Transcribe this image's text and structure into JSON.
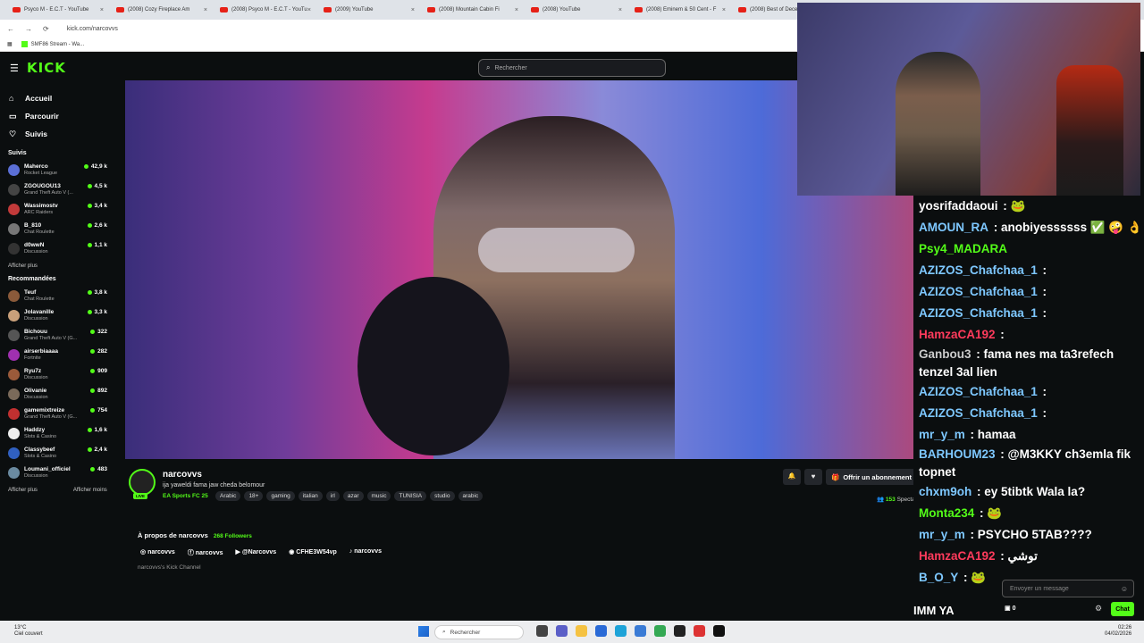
{
  "browser": {
    "tabs": [
      {
        "label": "Psyco M - E.C.T - YouTube"
      },
      {
        "label": "(2008) Cozy Fireplace Am"
      },
      {
        "label": "(2008) Psyco M - E.C.T - YouTu"
      },
      {
        "label": "(2009) YouTube"
      },
      {
        "label": "(2008) Mountain Cabin Fi"
      },
      {
        "label": "(2008) YouTube"
      },
      {
        "label": "(2008) Eminem & 50 Cent - F"
      },
      {
        "label": "(2008) Best of Dece"
      }
    ],
    "url": "kick.com/narcovvs",
    "bookmark": "SMF86 Stream - Wa..."
  },
  "header": {
    "logo": "KICK",
    "search_placeholder": "Rechercher"
  },
  "sidebar": {
    "nav": [
      {
        "label": "Accueil",
        "icon": "home-icon"
      },
      {
        "label": "Parcourir",
        "icon": "browse-icon"
      },
      {
        "label": "Suivis",
        "icon": "heart-icon"
      }
    ],
    "followed_title": "Suivis",
    "followed": [
      {
        "name": "Maherco",
        "category": "Rocket League",
        "viewers": "42,9 k",
        "color": "#5b6fd6"
      },
      {
        "name": "ZGOUGOU13",
        "category": "Grand Theft Auto V (...",
        "viewers": "4,5 k",
        "color": "#444"
      },
      {
        "name": "Wassimostv",
        "category": "ARC Raiders",
        "viewers": "3,4 k",
        "color": "#c23a3a"
      },
      {
        "name": "B_810",
        "category": "Chat Roulette",
        "viewers": "2,6 k",
        "color": "#777"
      },
      {
        "name": "d0wwN",
        "category": "Discussion",
        "viewers": "1,1 k",
        "color": "#333"
      }
    ],
    "followed_more": "Afficher plus",
    "recommended_title": "Recommandées",
    "recommended": [
      {
        "name": "Teuf",
        "category": "Chat Roulette",
        "viewers": "3,8 k",
        "color": "#8a5a3a"
      },
      {
        "name": "Jolavanille",
        "category": "Discussion",
        "viewers": "3,3 k",
        "color": "#c9a07a"
      },
      {
        "name": "Bichouu",
        "category": "Grand Theft Auto V (G...",
        "viewers": "322",
        "color": "#555"
      },
      {
        "name": "airserbiaaaa",
        "category": "Fortnite",
        "viewers": "282",
        "color": "#a030b0"
      },
      {
        "name": "Ryu7z",
        "category": "Discussion",
        "viewers": "909",
        "color": "#9a5a3a"
      },
      {
        "name": "Olivanie",
        "category": "Discussion",
        "viewers": "892",
        "color": "#7a6a5a"
      },
      {
        "name": "gamemixtreize",
        "category": "Grand Theft Auto V (G...",
        "viewers": "754",
        "color": "#c03030"
      },
      {
        "name": "Haddzy",
        "category": "Slots & Casino",
        "viewers": "1,6 k",
        "color": "#eee"
      },
      {
        "name": "Classybeef",
        "category": "Slots & Casino",
        "viewers": "2,4 k",
        "color": "#3060c0"
      },
      {
        "name": "Loumani_officiel",
        "category": "Discussion",
        "viewers": "483",
        "color": "#6a8aa0"
      }
    ],
    "show_more": "Afficher plus",
    "show_less": "Afficher moins"
  },
  "channel": {
    "name": "narcovvs",
    "title": "ija yaweldi fama jaw cheda belomour",
    "category": "EA Sports FC 25",
    "live": "LIVE",
    "tags": [
      "Arabic",
      "18+",
      "gaming",
      "italian",
      "irl",
      "azar",
      "music",
      "TUNISIA",
      "studio",
      "arabic"
    ],
    "subscribe": "Offrir un abonnement",
    "viewers_count": "153",
    "viewers_label": "Spectateurs",
    "about_title": "À propos de narcovvs",
    "followers": "268 Followers",
    "socials": [
      {
        "icon": "instagram-icon",
        "glyph": "◎",
        "label": "narcovvs"
      },
      {
        "icon": "facebook-icon",
        "glyph": "ⓕ",
        "label": "narcovvs"
      },
      {
        "icon": "youtube-icon",
        "glyph": "▶",
        "label": "@Narcovvs"
      },
      {
        "icon": "discord-icon",
        "glyph": "◉",
        "label": "CFHE3W54vp"
      },
      {
        "icon": "tiktok-icon",
        "glyph": "♪",
        "label": "narcovvs"
      }
    ],
    "description": "narcovvs's Kick Channel"
  },
  "chat": {
    "messages": [
      {
        "user": "yosrifaddaoui",
        "color": "#ffffff",
        "text": " : 🐸"
      },
      {
        "user": "AMOUN_RA",
        "color": "#7ec8ff",
        "text": " : anobiyessssss ✅ 🤪 👌"
      },
      {
        "user": "Psy4_MADARA",
        "color": "#53fc18",
        "text": ""
      },
      {
        "user": "AZIZOS_Chafchaa_1",
        "color": "#7ec8ff",
        "text": " :"
      },
      {
        "user": "AZIZOS_Chafchaa_1",
        "color": "#7ec8ff",
        "text": " :"
      },
      {
        "user": "AZIZOS_Chafchaa_1",
        "color": "#7ec8ff",
        "text": " :"
      },
      {
        "user": "HamzaCA192",
        "color": "#ff3b5c",
        "text": " :"
      },
      {
        "user": "Ganbou3",
        "color": "#cccccc",
        "text": " : fama nes ma ta3refech tenzel 3al lien",
        "wrap": true
      },
      {
        "user": "AZIZOS_Chafchaa_1",
        "color": "#7ec8ff",
        "text": " :"
      },
      {
        "user": "AZIZOS_Chafchaa_1",
        "color": "#7ec8ff",
        "text": " :"
      },
      {
        "user": "mr_y_m",
        "color": "#7ec8ff",
        "text": " : hamaa"
      },
      {
        "user": "BARHOUM23",
        "color": "#7ec8ff",
        "text": " : @M3KKY ch3emla fik topnet",
        "wrap": true
      },
      {
        "user": "chxm9oh",
        "color": "#7ec8ff",
        "text": " : ey 5tibtk Wala la?"
      },
      {
        "user": "Monta234",
        "color": "#53fc18",
        "text": " : 🐸"
      },
      {
        "user": "mr_y_m",
        "color": "#7ec8ff",
        "text": " : PSYCHO 5TAB????"
      },
      {
        "user": "HamzaCA192",
        "color": "#ff3b5c",
        "text": " : توشي"
      },
      {
        "user": "B_O_Y",
        "color": "#7ec8ff",
        "text": " : 🐸"
      }
    ],
    "input_placeholder": "Envoyer un message",
    "points": "0",
    "send_label": "Chat",
    "caption": "IMM YA"
  },
  "taskbar": {
    "weather_temp": "13°C",
    "weather_desc": "Ciel couvert",
    "search": "Rechercher",
    "time": "02:26",
    "date": "04/02/2026"
  }
}
